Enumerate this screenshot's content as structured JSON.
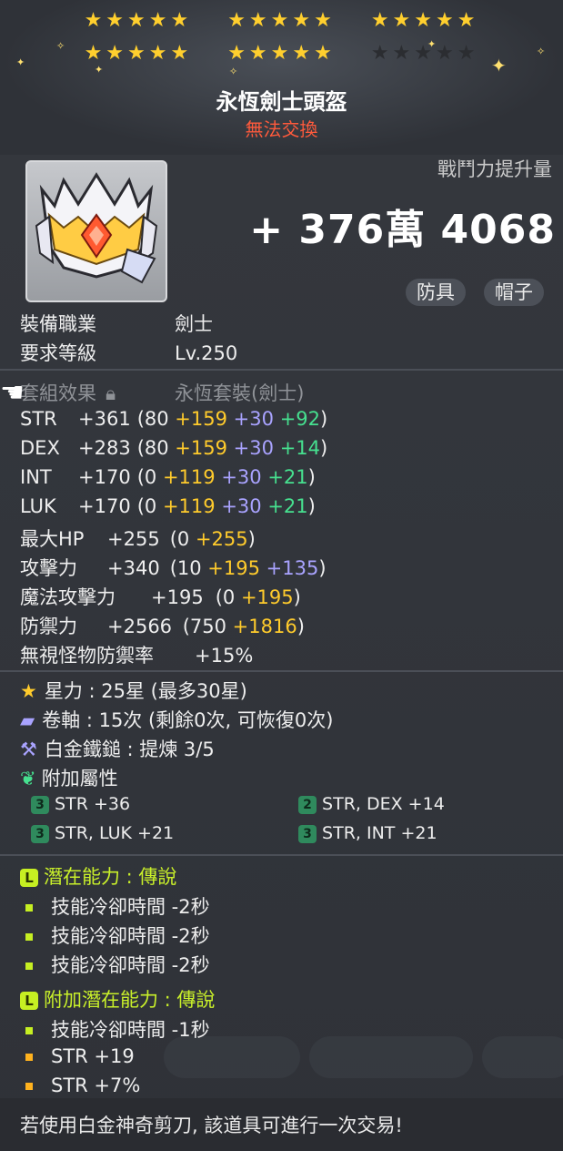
{
  "stars": {
    "row1": [
      "★★★★★",
      "★★★★★",
      "★★★★★"
    ],
    "row2_filled": [
      "★★★★★",
      "★★★★★"
    ],
    "row2_empty": "★★★★★"
  },
  "item": {
    "name": "永恆劍士頭盔",
    "trade_status": "無法交換",
    "icon": "helmet-icon"
  },
  "combat_power": {
    "label": "戰鬥力提升量",
    "value": "+ 376萬 4068"
  },
  "tags": [
    "防具",
    "帽子"
  ],
  "requirements": [
    {
      "label": "裝備職業",
      "value": "劍士"
    },
    {
      "label": "要求等級",
      "value": "Lv.250"
    }
  ],
  "set_effect": {
    "label": "套組效果",
    "value": "永恆套裝(劍士)"
  },
  "stats": [
    {
      "name": "STR",
      "total": "+361",
      "base": "(80",
      "y": "+159",
      "p": "+30",
      "g": "+92",
      "close": ")"
    },
    {
      "name": "DEX",
      "total": "+283",
      "base": "(80",
      "y": "+159",
      "p": "+30",
      "g": "+14",
      "close": ")"
    },
    {
      "name": "INT",
      "total": "+170",
      "base": "(0",
      "y": "+119",
      "p": "+30",
      "g": "+21",
      "close": ")"
    },
    {
      "name": "LUK",
      "total": "+170",
      "base": "(0",
      "y": "+119",
      "p": "+30",
      "g": "+21",
      "close": ")"
    },
    {
      "name": "最大HP",
      "total": "+255",
      "base": "(0",
      "y": "+255",
      "p": "",
      "g": "",
      "close": ")"
    },
    {
      "name": "攻擊力",
      "total": "+340",
      "base": "(10",
      "y": "+195",
      "p": "+135",
      "g": "",
      "close": ")"
    },
    {
      "name": "魔法攻擊力",
      "total": "+195",
      "base": "(0",
      "y": "+195",
      "p": "",
      "g": "",
      "close": ")"
    },
    {
      "name": "防禦力",
      "total": "+2566",
      "base": "(750",
      "y": "+1816",
      "p": "",
      "g": "",
      "close": ")"
    },
    {
      "name": "無視怪物防禦率",
      "total": "+15%",
      "base": "",
      "y": "",
      "p": "",
      "g": "",
      "close": ""
    }
  ],
  "enhance": {
    "starforce": "星力 : 25星 (最多30星)",
    "scroll": "卷軸 : 15次 (剩餘0次, 可恢復0次)",
    "hammer": "白金鐵鎚 : 提煉 3/5",
    "flame_label": "附加屬性"
  },
  "flames": [
    {
      "badge": "3",
      "text": "STR  +36"
    },
    {
      "badge": "2",
      "text": "STR, DEX  +14"
    },
    {
      "badge": "3",
      "text": "STR, LUK  +21"
    },
    {
      "badge": "3",
      "text": "STR, INT  +21"
    }
  ],
  "potential": {
    "label": "潛在能力 : 傳說",
    "lines": [
      "技能冷卻時間 -2秒",
      "技能冷卻時間 -2秒",
      "技能冷卻時間 -2秒"
    ]
  },
  "bonus_potential": {
    "label": "附加潛在能力 : 傳說",
    "lines": [
      "技能冷卻時間 -1秒",
      "STR +19",
      "STR +7%"
    ]
  },
  "footer": "若使用白金神奇剪刀, 該道具可進行一次交易!",
  "colors": {
    "gold": "#ffcb2c",
    "purple": "#a9a3ff",
    "green": "#46e08f",
    "lime": "#c6ef22",
    "red": "#ff5a3c"
  }
}
